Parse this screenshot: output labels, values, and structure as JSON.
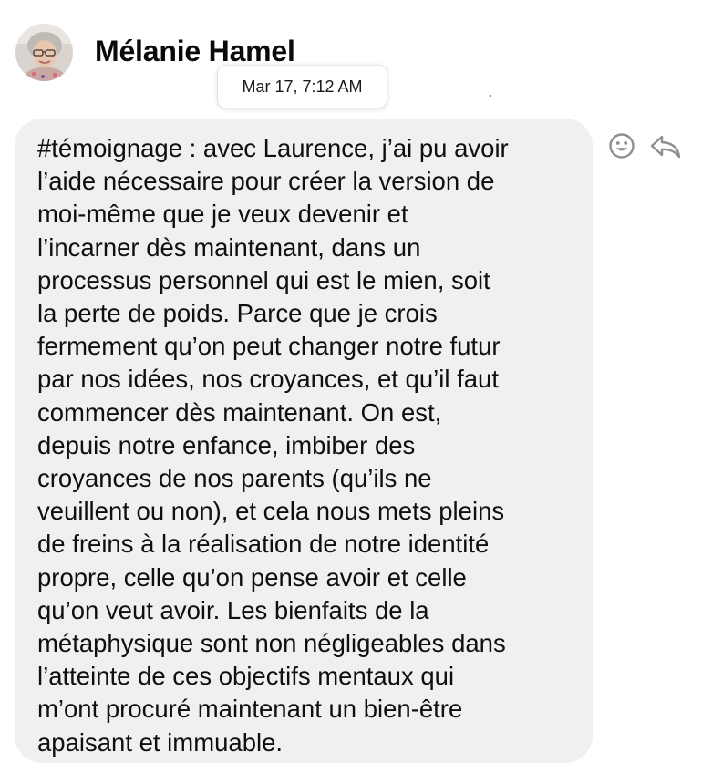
{
  "message": {
    "sender_name": "Mélanie Hamel",
    "timestamp": "Mar 17, 7:12 AM",
    "text": "#témoignage : avec Laurence, j’ai pu avoir\nl’aide nécessaire pour créer la version de\nmoi-même que je veux devenir et\nl’incarner dès maintenant, dans un\nprocessus personnel qui est le mien, soit\nla perte de poids. Parce que je crois\nfermement qu’on peut changer notre futur\npar nos idées, nos croyances, et qu’il faut\ncommencer dès maintenant. On est,\ndepuis notre enfance, imbiber des\ncroyances de nos parents (qu’ils ne\nveuillent ou non), et cela nous mets pleins\nde freins à la réalisation de notre identité\npropre, celle qu’on pense avoir et celle\nqu’on veut avoir. Les bienfaits de la\nmétaphysique sont non négligeables dans\nl’atteinte de ces objectifs mentaux qui\nm’ont procuré maintenant un bien-être\napaisant et immuable."
  },
  "actions": {
    "react_icon": "smiley-face-icon",
    "reply_icon": "reply-arrow-icon"
  },
  "colors": {
    "bubble_background": "#f0f0f0",
    "icon_gray": "#8e8e93"
  }
}
